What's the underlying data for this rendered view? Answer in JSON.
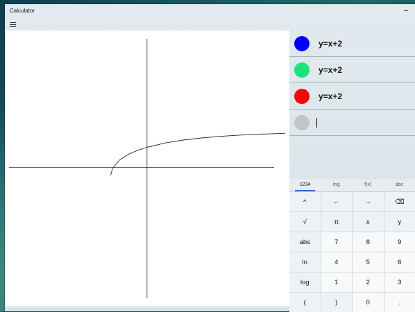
{
  "window": {
    "title": "Calculator"
  },
  "equations": [
    {
      "text": "y=x+2",
      "color": "#0000ff"
    },
    {
      "text": "y=x+2",
      "color": "#1de27c"
    },
    {
      "text": "y=x+2",
      "color": "#ff0000"
    }
  ],
  "new_equation": {
    "value": "",
    "color": "#c4c4c4"
  },
  "keypad": {
    "tabs": [
      "1234",
      "trig",
      "f(x)",
      "abc"
    ],
    "active_tab": "1234",
    "keys": [
      "^",
      "←",
      "→",
      "⌫",
      "√",
      "π",
      "x",
      "y",
      "abs",
      "7",
      "8",
      "9",
      "ln",
      "4",
      "5",
      "6",
      "log",
      "1",
      "2",
      "3",
      "(",
      ")",
      "0",
      "."
    ]
  },
  "chart_data": {
    "type": "line",
    "title": "",
    "xlabel": "",
    "ylabel": "",
    "grid": false,
    "x": [
      -2,
      -1.9,
      -1.5,
      -1,
      -0.5,
      0,
      1,
      2,
      3,
      4,
      5,
      6,
      7.6
    ],
    "series": [
      {
        "values": [
          -0.4,
          -0.05,
          0.4,
          0.7,
          0.9,
          1.05,
          1.28,
          1.43,
          1.54,
          1.62,
          1.68,
          1.73,
          1.78
        ]
      }
    ],
    "xlim": [
      -7.6,
      7.0
    ],
    "ylim": [
      -6.8,
      6.7
    ]
  }
}
